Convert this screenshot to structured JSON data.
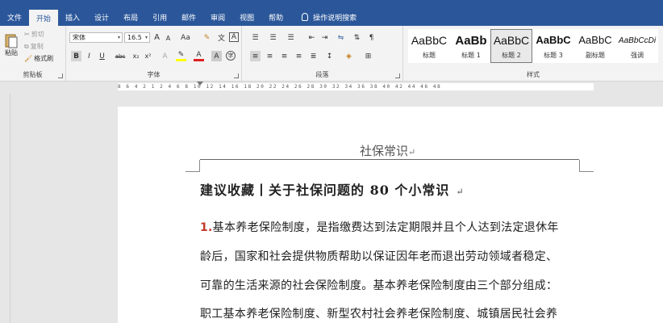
{
  "tabs": [
    "文件",
    "开始",
    "插入",
    "设计",
    "布局",
    "引用",
    "邮件",
    "审阅",
    "视图",
    "帮助"
  ],
  "active_tab": "开始",
  "tell_me": "操作说明搜索",
  "clipboard": {
    "paste": "粘贴",
    "cut": "剪切",
    "copy": "复制",
    "format_painter": "格式刷",
    "label": "剪贴板"
  },
  "font": {
    "name": "宋体",
    "size": "16.5",
    "grow": "A",
    "shrink": "A",
    "case": "Aa",
    "bold": "B",
    "italic": "I",
    "underline": "U",
    "strike": "abc",
    "sub": "x₂",
    "sup": "x²",
    "label": "字体"
  },
  "paragraph": {
    "label": "段落"
  },
  "styles": {
    "label": "样式",
    "items": [
      {
        "sample": "AaBbC",
        "name": "标题"
      },
      {
        "sample": "AaBb",
        "name": "标题 1"
      },
      {
        "sample": "AaBbC",
        "name": "标题 2"
      },
      {
        "sample": "AaBbC",
        "name": "标题 3"
      },
      {
        "sample": "AaBbC",
        "name": "副标题"
      },
      {
        "sample": "AaBbCcDi",
        "name": "强调"
      }
    ]
  },
  "ruler_numbers": "8 6 4 2 1 2 4 6 8 10 12 14 16 18 20 22 24 26 28 30 32 34 36 38 40 42 44 46 48",
  "document": {
    "header": "社保常识",
    "title": "建议收藏丨关于社保问题的 80 个小常识",
    "para_num": "1.",
    "lines": [
      "基本养老保险制度，是指缴费达到法定期限并且个人达到法定退休年",
      "龄后，国家和社会提供物质帮助以保证因年老而退出劳动领域者稳定、",
      "可靠的生活来源的社会保险制度。基本养老保险制度由三个部分组成：",
      "职工基本养老保险制度、新型农村社会养老保险制度、城镇居民社会养"
    ]
  }
}
